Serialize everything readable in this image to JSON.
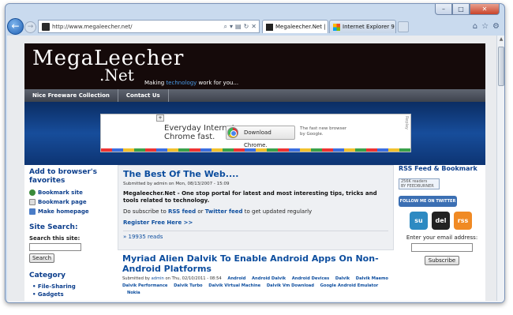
{
  "browser": {
    "url": "http://www.megaleecher.net/",
    "tabs": [
      {
        "label": "Megaleecher.Net | ...",
        "active": true
      },
      {
        "label": "Internet Explorer 9 - Mi...",
        "active": false
      }
    ]
  },
  "site": {
    "logo_line1": "MegaLeecher",
    "logo_line2": ".Net",
    "tagline_pre": "Making ",
    "tagline_link": "technology",
    "tagline_post": " work for you...",
    "menu": [
      "Nice Freeware Collection",
      "Contact Us"
    ],
    "ad": {
      "headline": "Everyday Internet.\nChrome fast.",
      "button": "Download Chrome.",
      "small": "The fast new browser\nby Google.",
      "replay": "Replay"
    },
    "left": {
      "favorites_heading": "Add to browser's favorites",
      "favorites_items": [
        "Bookmark site",
        "Bookmark page",
        "Make homepage"
      ],
      "search_heading": "Site Search:",
      "search_label": "Search this site:",
      "search_button": "Search",
      "category_heading": "Category",
      "categories": [
        "File-Sharing",
        "Gadgets"
      ]
    },
    "post1": {
      "title": "The Best Of The Web....",
      "meta": "Submitted by admin on Mon, 08/13/2007 - 15:09",
      "body": "Megaleecher.Net - One stop portal for latest and most interesting tips, tricks and tools related to technology.",
      "subscribe_pre": "Do subscribe to ",
      "rss": "RSS feed",
      "or": " or ",
      "twitter": "Twitter feed",
      "subscribe_post": " to get updated regularly",
      "register": "Register Free Here >>",
      "reads": "19935 reads"
    },
    "post2": {
      "title": "Myriad Alien Dalvik To Enable Android Apps On Non-Android Platforms",
      "meta_pre": "Submitted by ",
      "meta_user": "admin",
      "meta_post": " on Thu, 02/10/2011 - 08:54",
      "tags": [
        "Android",
        "Android Dalvik",
        "Android Devices",
        "Dalvik",
        "Dalvik Maemo",
        "Dalvik Performance",
        "Dalvik Turbo",
        "Dalvik Virtual Machine",
        "Dalvik Vm Download",
        "Google Android Emulator",
        "Nokia"
      ]
    },
    "right": {
      "heading": "RSS Feed & Bookmark",
      "feedburner": "256K readers\nBY FEEDBURNER",
      "twitter_btn": "FOLLOW ME ON TWITTER",
      "social": [
        "su",
        "del",
        "rss"
      ],
      "email_label": "Enter your email address:",
      "subscribe": "Subscribe"
    }
  }
}
